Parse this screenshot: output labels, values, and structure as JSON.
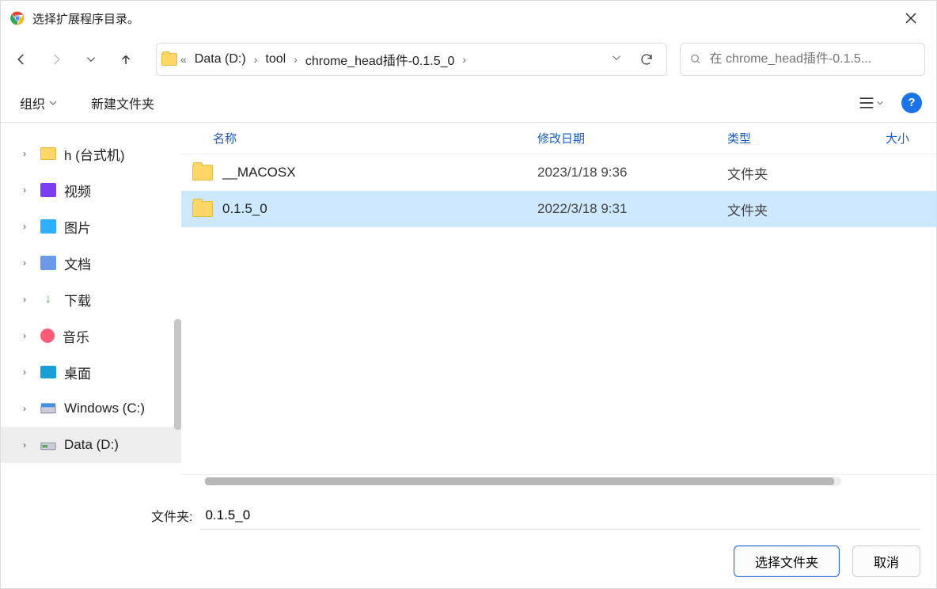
{
  "title": "选择扩展程序目录。",
  "breadcrumbs": {
    "b0": "«",
    "b1": "Data (D:)",
    "b2": "tool",
    "b3": "chrome_head插件-0.1.5_0"
  },
  "search": {
    "placeholder": "在 chrome_head插件-0.1.5..."
  },
  "toolbar": {
    "organize": "组织",
    "newfolder": "新建文件夹"
  },
  "columns": {
    "name": "名称",
    "modified": "修改日期",
    "type": "类型",
    "size": "大小"
  },
  "sidebar": {
    "items": [
      {
        "label": "h (台式机)"
      },
      {
        "label": "视频"
      },
      {
        "label": "图片"
      },
      {
        "label": "文档"
      },
      {
        "label": "下载"
      },
      {
        "label": "音乐"
      },
      {
        "label": "桌面"
      },
      {
        "label": "Windows (C:)"
      },
      {
        "label": "Data (D:)"
      }
    ]
  },
  "files": [
    {
      "name": "__MACOSX",
      "date": "2023/1/18 9:36",
      "type": "文件夹",
      "selected": false
    },
    {
      "name": "0.1.5_0",
      "date": "2022/3/18 9:31",
      "type": "文件夹",
      "selected": true
    }
  ],
  "footer": {
    "label": "文件夹:",
    "value": "0.1.5_0",
    "select": "选择文件夹",
    "cancel": "取消"
  }
}
